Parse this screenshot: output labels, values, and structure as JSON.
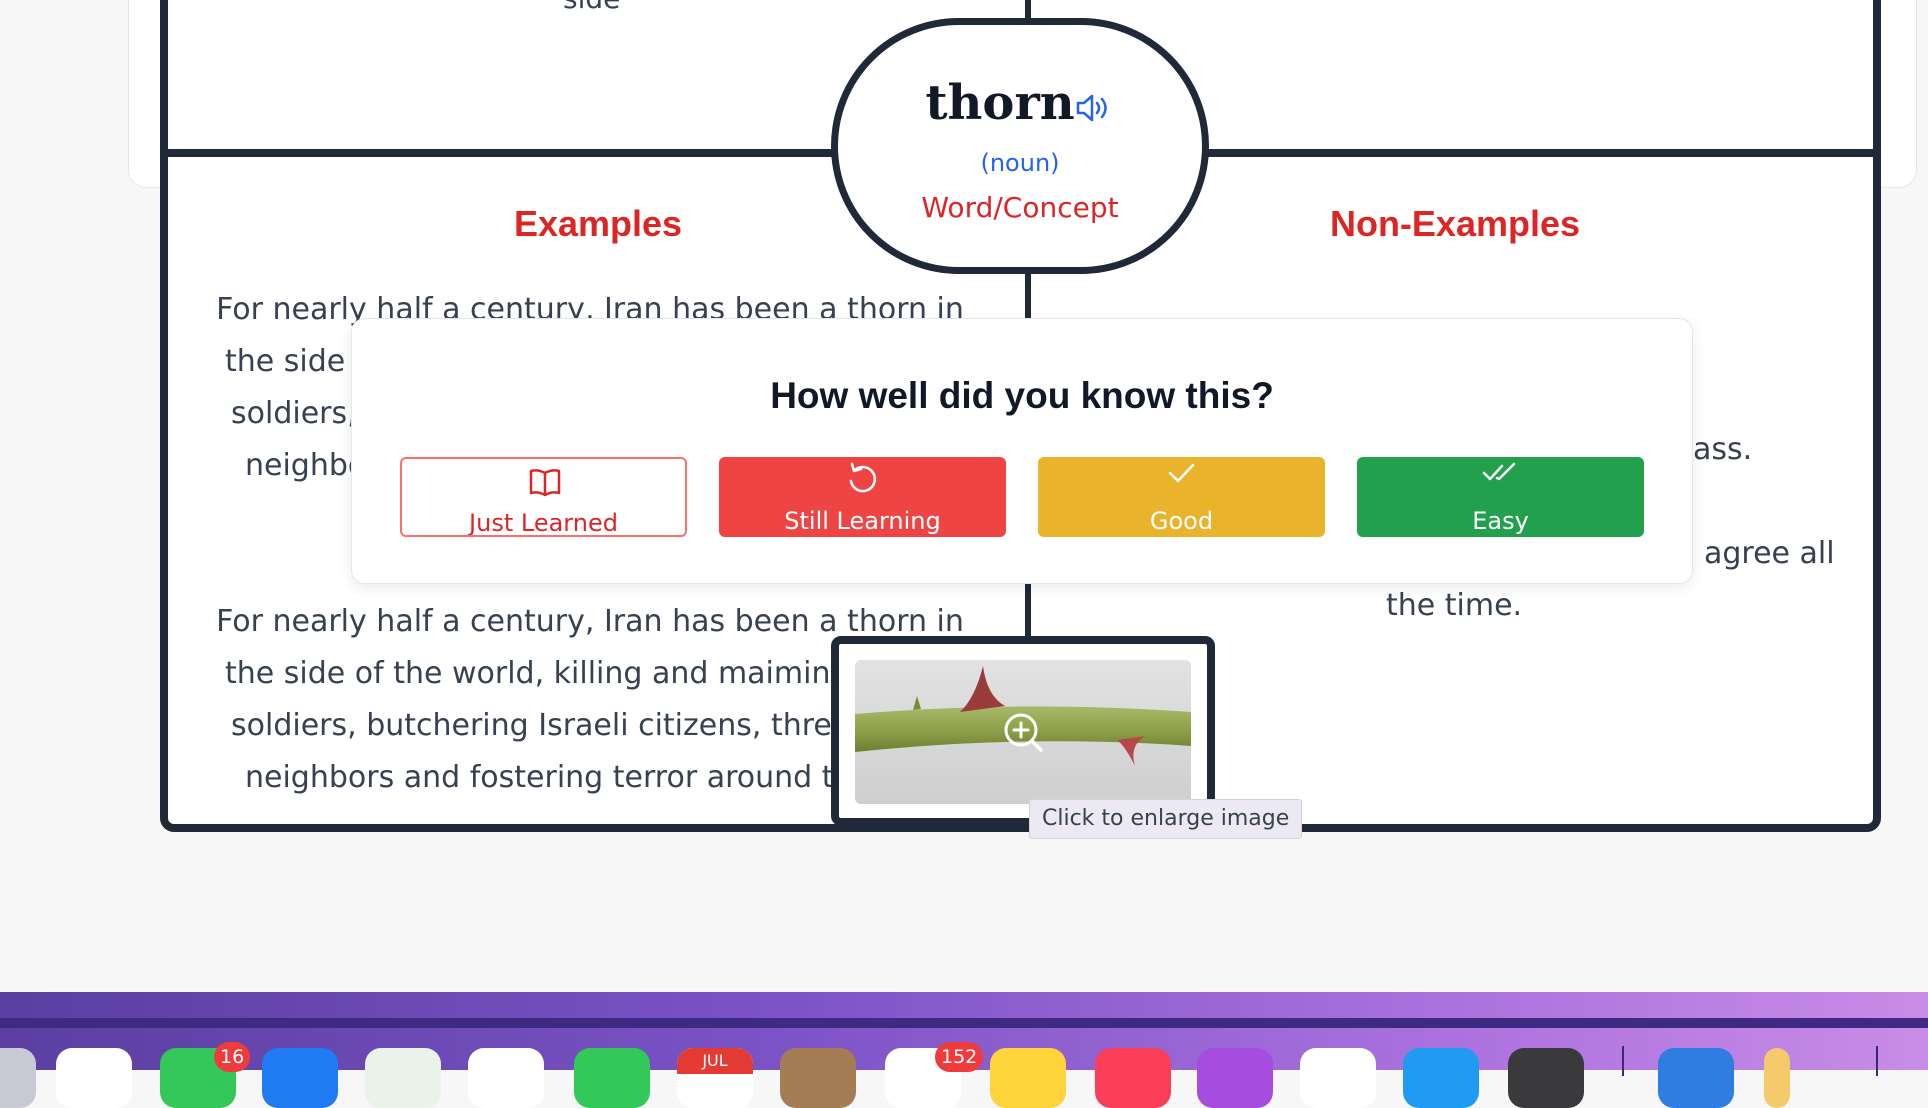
{
  "concept": {
    "word": "thorn",
    "part_of_speech": "(noun)",
    "label": "Word/Concept"
  },
  "top_fragment": "side",
  "examples": {
    "title": "Examples",
    "first_lines": [
      "For nearly half a century, Iran has been a thorn in",
      "the side",
      "soldiers,",
      "neighbo"
    ],
    "second_lines": [
      "For nearly half a century, Iran has been a thorn in",
      "the side of the world, killing and maiming A",
      "soldiers, butchering Israeli citizens, threat",
      "neighbors and fostering terror around th"
    ]
  },
  "non_examples": {
    "title": "Non-Examples",
    "fragment_a": "ass.",
    "fragment_b": "agree all",
    "fragment_c": "the time."
  },
  "rating_modal": {
    "title": "How well did you know this?",
    "buttons": [
      {
        "label": "Just Learned",
        "icon": "book-open-icon"
      },
      {
        "label": "Still Learning",
        "icon": "rotate-ccw-icon"
      },
      {
        "label": "Good",
        "icon": "check-icon"
      },
      {
        "label": "Easy",
        "icon": "check-check-icon"
      }
    ]
  },
  "image": {
    "tooltip": "Click to enlarge image",
    "zoom_icon": "zoom-in-icon"
  },
  "dock": {
    "badges": [
      "16",
      "152"
    ],
    "calendar_month": "JUL"
  },
  "colors": {
    "accent_red": "#dc2626",
    "accent_blue": "#2563eb",
    "border_dark": "#1f2937",
    "btn_still": "#ef4444",
    "btn_good": "#e9b32b",
    "btn_easy": "#22a04e"
  }
}
